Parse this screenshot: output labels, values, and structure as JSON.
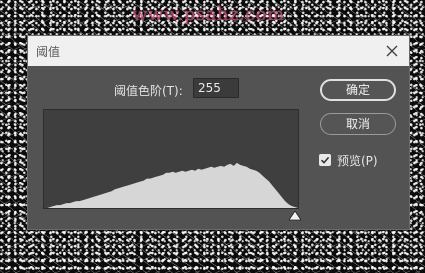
{
  "watermark": "www.psahz.com",
  "dialog": {
    "title": "阈值",
    "threshold_label": "阈值色阶(T):",
    "threshold_value": "255",
    "ok_label": "确定",
    "cancel_label": "取消",
    "preview_label": "预览(P)",
    "preview_checked": true
  },
  "colors": {
    "dialog_bg": "#535353",
    "histogram_bg": "#3f3f3f",
    "histogram_fill": "#d6d6d6"
  },
  "histogram": {
    "levels": [
      0,
      0,
      1,
      2,
      3,
      3,
      4,
      5,
      5,
      6,
      7,
      7,
      8,
      9,
      10,
      11,
      12,
      13,
      14,
      15,
      16,
      17,
      19,
      20,
      21,
      22,
      23,
      24,
      25,
      26,
      27,
      28,
      30,
      30,
      31,
      32,
      33,
      34,
      36,
      36,
      37,
      36,
      37,
      38,
      37,
      38,
      39,
      38,
      40,
      39,
      40,
      41,
      42,
      41,
      42,
      43,
      42,
      44,
      45,
      43,
      46,
      44,
      43,
      42,
      40,
      39,
      38,
      36,
      33,
      30,
      27,
      23,
      19,
      15,
      11,
      7,
      4,
      2,
      1,
      0
    ],
    "slider_level": 255
  }
}
